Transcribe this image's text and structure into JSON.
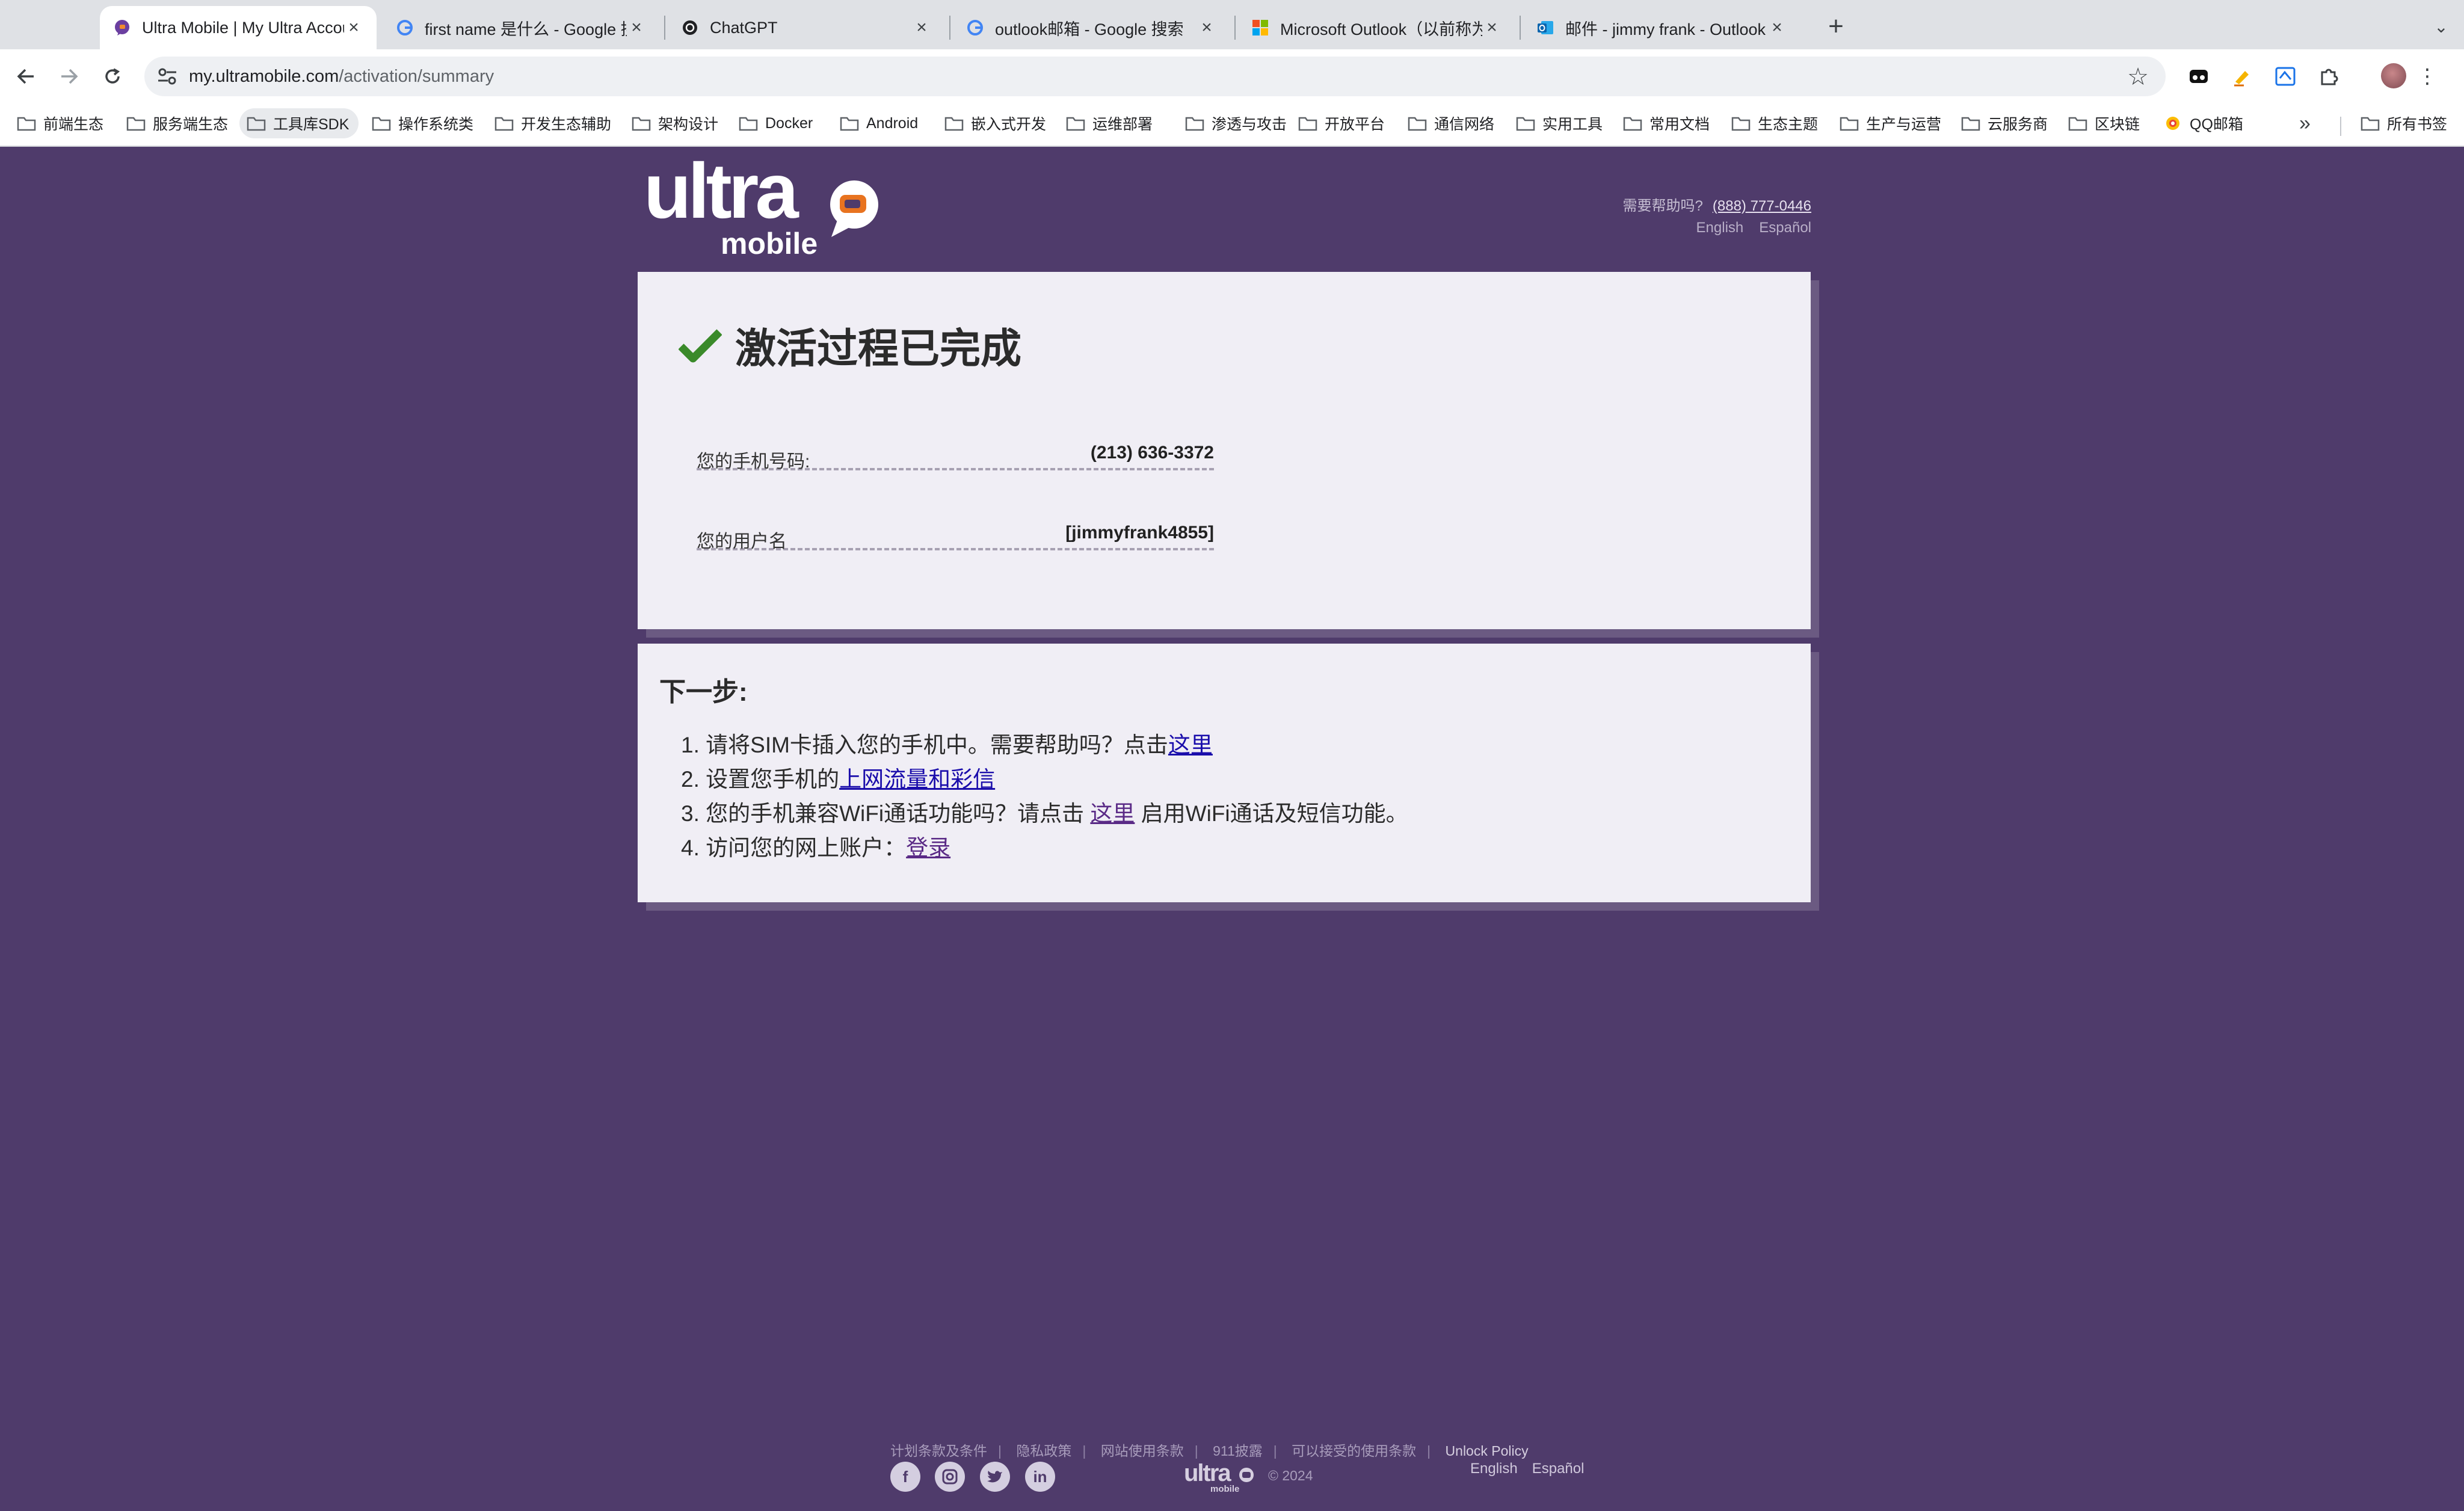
{
  "browser": {
    "tabs": [
      {
        "title": "Ultra Mobile | My Ultra Account",
        "favicon": "ultra-mobile-icon",
        "active": true
      },
      {
        "title": "first name 是什么 - Google 搜索",
        "favicon": "google-icon",
        "active": false
      },
      {
        "title": "ChatGPT",
        "favicon": "chatgpt-icon",
        "active": false
      },
      {
        "title": "outlook邮箱 - Google 搜索",
        "favicon": "google-icon",
        "active": false
      },
      {
        "title": "Microsoft Outlook（以前称为 Hotmail）",
        "favicon": "microsoft-icon",
        "active": false
      },
      {
        "title": "邮件 - jimmy frank - Outlook",
        "favicon": "outlook-icon",
        "active": false
      }
    ],
    "url": {
      "host": "my.ultramobile.com",
      "path": "/activation/summary"
    },
    "bookmarks": [
      "前端生态",
      "服务端生态",
      "工具库SDK",
      "操作系统类",
      "开发生态辅助",
      "架构设计",
      "Docker",
      "Android",
      "嵌入式开发",
      "运维部署",
      "渗透与攻击",
      "开放平台",
      "通信网络",
      "实用工具",
      "常用文档",
      "生态主题",
      "生产与运营",
      "云服务商",
      "区块链",
      "QQ邮箱"
    ],
    "bookmarks_all": "所有书签"
  },
  "header": {
    "logo_text": "ultra",
    "logo_sub": "mobile",
    "help_label": "需要帮助吗?",
    "help_phone": "(888) 777-0446",
    "lang_en": "English",
    "lang_es": "Español"
  },
  "summary": {
    "title": "激活过程已完成",
    "phone_label": "您的手机号码:",
    "phone_value": "(213) 636-3372",
    "username_label": "您的用户名",
    "username_value": "[jimmyfrank4855]"
  },
  "next_steps": {
    "title": "下一步:",
    "step1_prefix": "1. 请将SIM卡插入您的手机中。需要帮助吗？点击",
    "step1_link": "这里",
    "step2_prefix": "2. 设置您手机的",
    "step2_link": "上网流量和彩信",
    "step3_prefix": "3. 您的手机兼容WiFi通话功能吗？请点击 ",
    "step3_link": "这里",
    "step3_suffix": " 启用WiFi通话及短信功能。",
    "step4_prefix": "4. 访问您的网上账户：",
    "step4_link": "登录"
  },
  "footer": {
    "links": [
      "计划条款及条件",
      "隐私政策",
      "网站使用条款",
      "911披露",
      "可以接受的使用条款",
      "Unlock Policy"
    ],
    "copyright": "© 2024",
    "lang_en": "English",
    "lang_es": "Español",
    "social_icons": [
      "facebook-icon",
      "instagram-icon",
      "twitter-icon",
      "linkedin-icon"
    ]
  },
  "colors": {
    "page_bg": "#4f3b6b",
    "card_bg": "#f0eef5",
    "check_green": "#3a8a2a",
    "logo_orange": "#e8731f"
  }
}
